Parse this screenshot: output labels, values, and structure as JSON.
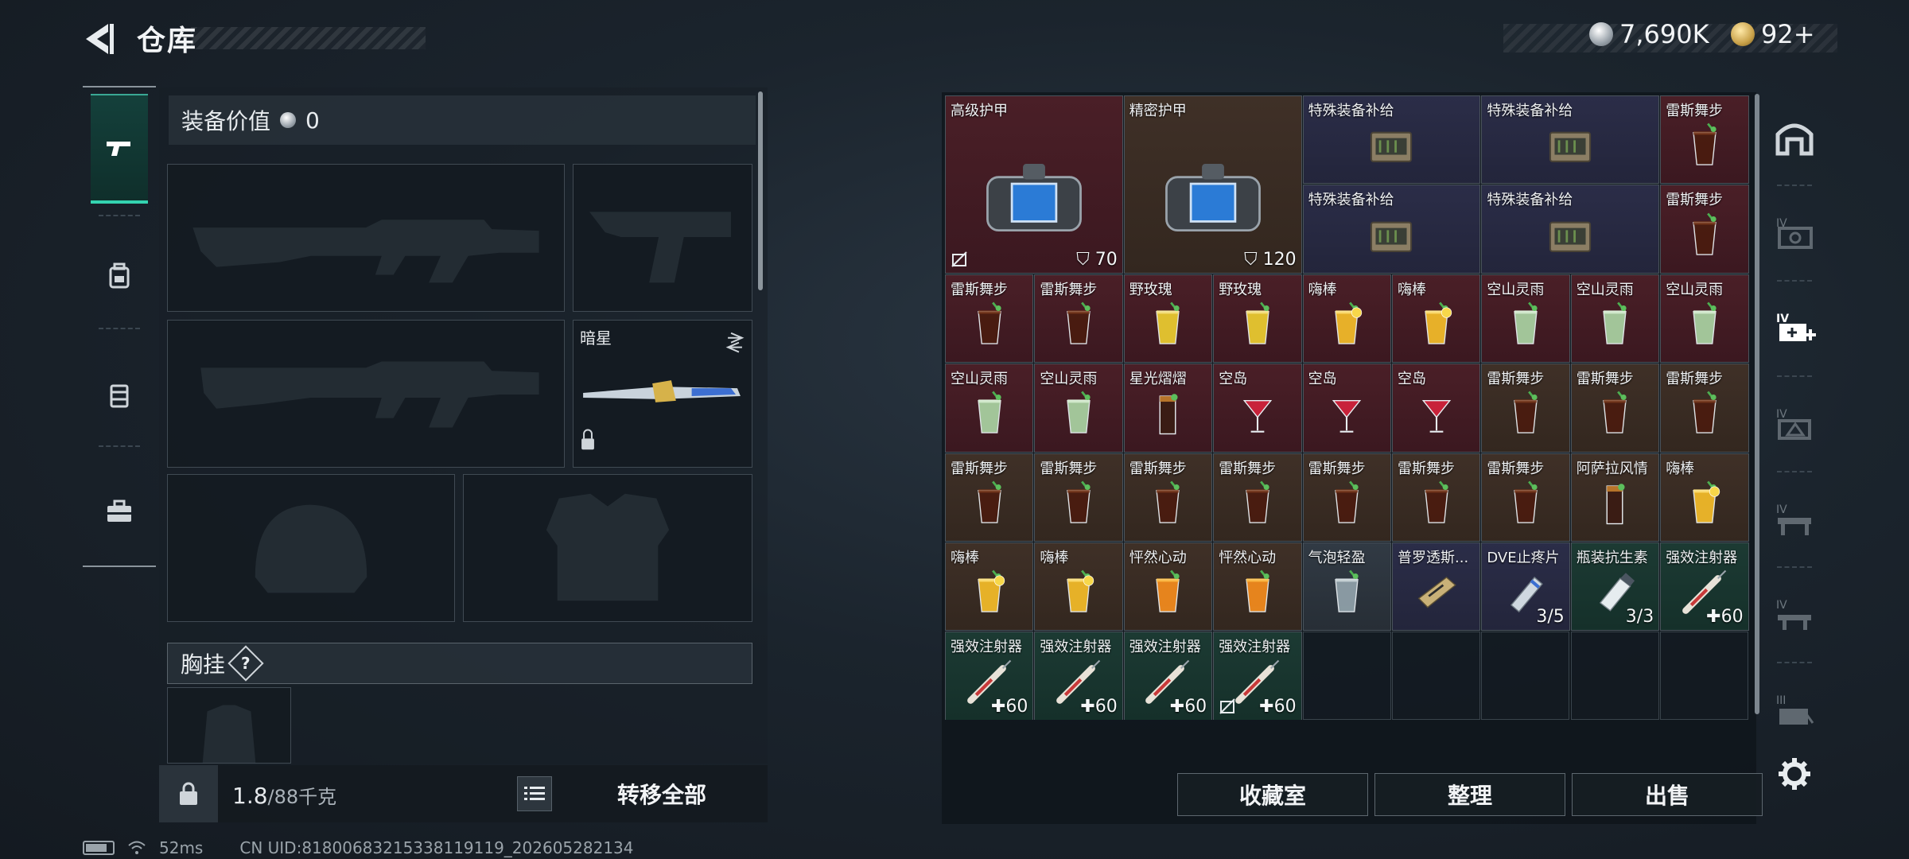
{
  "header": {
    "title": "仓库",
    "currency_silver": "7,690K",
    "currency_gold": "92+"
  },
  "loadout": {
    "value_label": "装备价值",
    "value": "0",
    "melee_name": "暗星",
    "chest_rig_label": "胸挂",
    "help": "?"
  },
  "footer_left": {
    "weight": "1.8",
    "capacity": "/88千克",
    "transfer_all": "转移全部"
  },
  "status_bar": {
    "ping": "52ms",
    "uid": "CN UID:818006832153381191​19_202605282134"
  },
  "inventory": {
    "items": [
      {
        "name": "高级护甲",
        "count": "70",
        "kind": "armor"
      },
      {
        "name": "精密护甲",
        "count": "120",
        "kind": "armor"
      },
      {
        "name": "特殊装备补给",
        "count": "",
        "kind": "crate"
      },
      {
        "name": "特殊装备补给",
        "count": "",
        "kind": "crate"
      },
      {
        "name": "雷斯舞步",
        "count": "",
        "kind": "drink-dark"
      },
      {
        "name": "特殊装备补给",
        "count": "",
        "kind": "crate"
      },
      {
        "name": "特殊装备补给",
        "count": "",
        "kind": "crate"
      },
      {
        "name": "雷斯舞步",
        "count": "",
        "kind": "drink-dark"
      },
      {
        "name": "雷斯舞步",
        "count": "",
        "kind": "drink-dark"
      },
      {
        "name": "雷斯舞步",
        "count": "",
        "kind": "drink-dark"
      },
      {
        "name": "野玫瑰",
        "count": "",
        "kind": "drink-yellow"
      },
      {
        "name": "野玫瑰",
        "count": "",
        "kind": "drink-yellow"
      },
      {
        "name": "嗨棒",
        "count": "",
        "kind": "drink-lemon"
      },
      {
        "name": "嗨棒",
        "count": "",
        "kind": "drink-lemon"
      },
      {
        "name": "空山灵雨",
        "count": "",
        "kind": "drink-green"
      },
      {
        "name": "空山灵雨",
        "count": "",
        "kind": "drink-green"
      },
      {
        "name": "空山灵雨",
        "count": "",
        "kind": "drink-green"
      },
      {
        "name": "空山灵雨",
        "count": "",
        "kind": "drink-green"
      },
      {
        "name": "空山灵雨",
        "count": "",
        "kind": "drink-green"
      },
      {
        "name": "星光熠熠",
        "count": "",
        "kind": "drink-tall"
      },
      {
        "name": "空岛",
        "count": "",
        "kind": "drink-red"
      },
      {
        "name": "空岛",
        "count": "",
        "kind": "drink-red"
      },
      {
        "name": "空岛",
        "count": "",
        "kind": "drink-red"
      },
      {
        "name": "雷斯舞步",
        "count": "",
        "kind": "drink-dark"
      },
      {
        "name": "雷斯舞步",
        "count": "",
        "kind": "drink-dark"
      },
      {
        "name": "雷斯舞步",
        "count": "",
        "kind": "drink-dark"
      },
      {
        "name": "雷斯舞步",
        "count": "",
        "kind": "drink-dark"
      },
      {
        "name": "雷斯舞步",
        "count": "",
        "kind": "drink-dark"
      },
      {
        "name": "雷斯舞步",
        "count": "",
        "kind": "drink-dark"
      },
      {
        "name": "雷斯舞步",
        "count": "",
        "kind": "drink-dark"
      },
      {
        "name": "雷斯舞步",
        "count": "",
        "kind": "drink-dark"
      },
      {
        "name": "雷斯舞步",
        "count": "",
        "kind": "drink-dark"
      },
      {
        "name": "雷斯舞步",
        "count": "",
        "kind": "drink-dark"
      },
      {
        "name": "阿萨拉风情",
        "count": "",
        "kind": "drink-tall"
      },
      {
        "name": "嗨棒",
        "count": "",
        "kind": "drink-lemon"
      },
      {
        "name": "嗨棒",
        "count": "",
        "kind": "drink-lemon"
      },
      {
        "name": "嗨棒",
        "count": "",
        "kind": "drink-lemon"
      },
      {
        "name": "怦然心动",
        "count": "",
        "kind": "drink-orange"
      },
      {
        "name": "怦然心动",
        "count": "",
        "kind": "drink-orange"
      },
      {
        "name": "气泡轻盈",
        "count": "",
        "kind": "drink-clear"
      },
      {
        "name": "普罗透斯...",
        "count": "",
        "kind": "device"
      },
      {
        "name": "DVE止疼片",
        "count": "3/5",
        "kind": "pills"
      },
      {
        "name": "瓶装抗生素",
        "count": "3/3",
        "kind": "bottle"
      },
      {
        "name": "强效注射器",
        "count": "60",
        "kind": "syringe"
      },
      {
        "name": "强效注射器",
        "count": "60",
        "kind": "syringe"
      },
      {
        "name": "强效注射器",
        "count": "60",
        "kind": "syringe"
      },
      {
        "name": "强效注射器",
        "count": "60",
        "kind": "syringe"
      },
      {
        "name": "强效注射器",
        "count": "60",
        "kind": "syringe"
      }
    ]
  },
  "actions": {
    "collection": "收藏室",
    "sort": "整理",
    "sell": "出售"
  },
  "rail": {
    "labels": [
      "",
      "IV",
      "IV",
      "IV",
      "IV",
      "IV",
      "III"
    ]
  },
  "colors": {
    "red": "#4a1f27",
    "brown": "#3f3027",
    "purple": "#2b2d48",
    "green": "#1c3a33",
    "accent": "#34d3b0"
  }
}
